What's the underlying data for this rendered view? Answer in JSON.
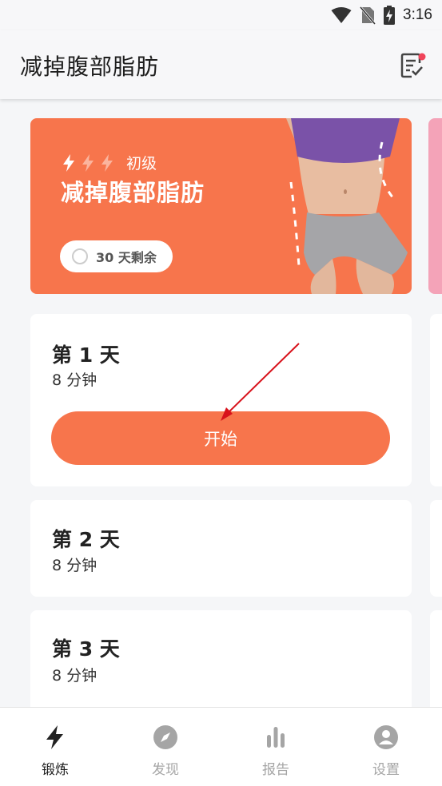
{
  "status_bar": {
    "time": "3:16"
  },
  "header": {
    "title": "减掉腹部脂肪"
  },
  "hero": {
    "level": "初级",
    "title": "减掉腹部脂肪",
    "days_left": "30 天剩余",
    "accent": "#f7754c"
  },
  "days": [
    {
      "title": "第 1 天",
      "duration": "8 分钟",
      "button": "开始"
    },
    {
      "title": "第 2 天",
      "duration": "8 分钟"
    },
    {
      "title": "第 3 天",
      "duration": "8 分钟"
    }
  ],
  "nav": {
    "items": [
      {
        "label": "锻炼",
        "icon": "lightning-icon",
        "active": true
      },
      {
        "label": "发现",
        "icon": "compass-icon",
        "active": false
      },
      {
        "label": "报告",
        "icon": "bar-chart-icon",
        "active": false
      },
      {
        "label": "设置",
        "icon": "person-icon",
        "active": false
      }
    ],
    "active_color": "#222222",
    "inactive_color": "#a5a5a5"
  }
}
